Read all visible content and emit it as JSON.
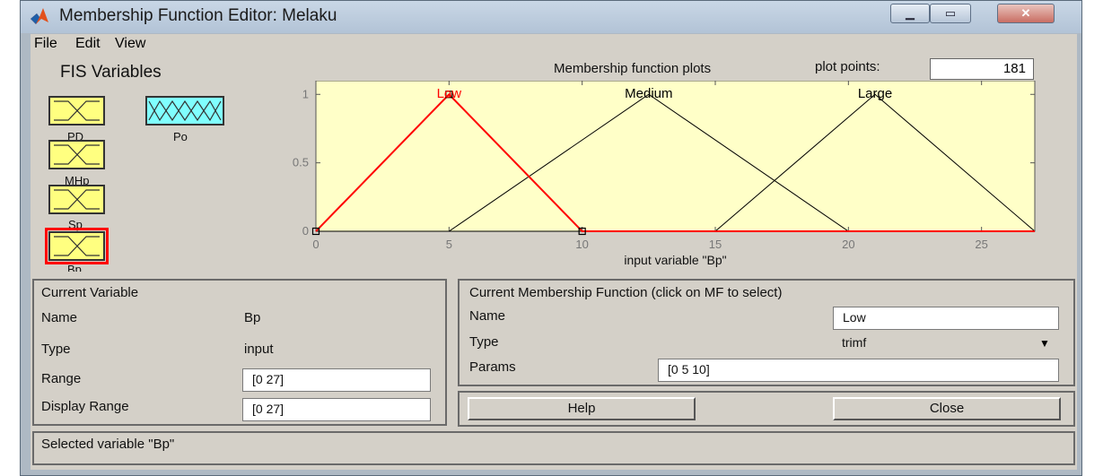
{
  "window": {
    "title": "Membership Function Editor: Melaku",
    "controls": {
      "minimize": "▁",
      "maximize": "▭",
      "close": "✕"
    }
  },
  "menu": [
    "File",
    "Edit",
    "View"
  ],
  "fis_variables": {
    "title": "FIS Variables",
    "variables": [
      {
        "name": "PD",
        "kind": "input",
        "selected": false
      },
      {
        "name": "Po",
        "kind": "output",
        "selected": false
      },
      {
        "name": "MHp",
        "kind": "input",
        "selected": false
      },
      {
        "name": "Sp",
        "kind": "input",
        "selected": false
      },
      {
        "name": "Bp",
        "kind": "input",
        "selected": true
      }
    ]
  },
  "plot": {
    "header": "Membership function plots",
    "plot_points_label": "plot points:",
    "plot_points": "181"
  },
  "chart_data": {
    "type": "line",
    "xlabel": "input variable \"Bp\"",
    "xlim": [
      0,
      27
    ],
    "ylim": [
      0,
      1.1
    ],
    "xticks": [
      0,
      5,
      10,
      15,
      20,
      25
    ],
    "yticks": [
      0,
      0.5,
      1
    ],
    "grid": false,
    "background": "#ffffc8",
    "series": [
      {
        "name": "Low",
        "x": [
          0,
          5,
          10,
          27
        ],
        "y": [
          0,
          1,
          0,
          0
        ],
        "color": "#ff0000",
        "selected": true
      },
      {
        "name": "Medium",
        "x": [
          0,
          5,
          12.5,
          20,
          27
        ],
        "y": [
          0,
          0,
          1,
          0,
          0
        ],
        "color": "#000000",
        "selected": false
      },
      {
        "name": "Large",
        "x": [
          0,
          15,
          21,
          27
        ],
        "y": [
          0,
          0,
          1,
          0
        ],
        "color": "#000000",
        "selected": false
      }
    ]
  },
  "current_variable": {
    "title": "Current Variable",
    "name_label": "Name",
    "name": "Bp",
    "type_label": "Type",
    "type": "input",
    "range_label": "Range",
    "range": "[0 27]",
    "display_range_label": "Display Range",
    "display_range": "[0 27]"
  },
  "current_mf": {
    "title": "Current Membership Function (click on MF to select)",
    "name_label": "Name",
    "name": "Low",
    "type_label": "Type",
    "type": "trimf",
    "params_label": "Params",
    "params": "[0 5 10]"
  },
  "buttons": {
    "help": "Help",
    "close": "Close"
  },
  "status": "Selected variable \"Bp\""
}
